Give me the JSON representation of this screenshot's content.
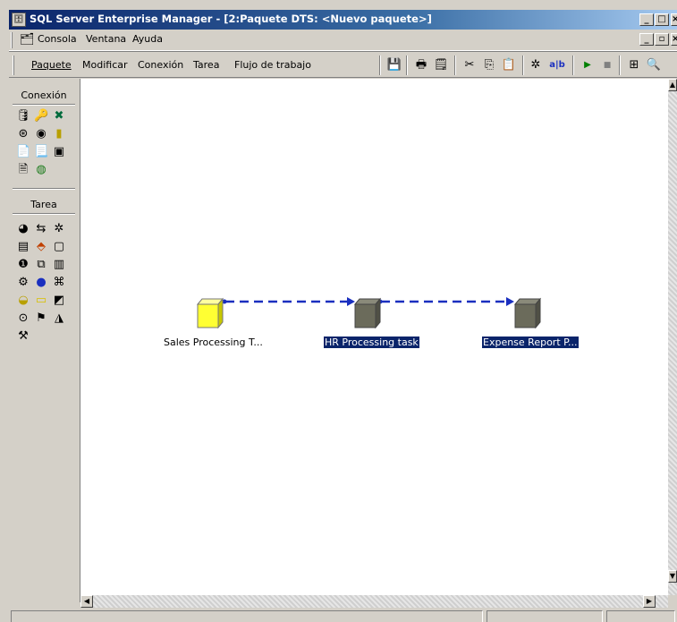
{
  "window": {
    "title": "SQL Server Enterprise Manager - [2:Paquete DTS: <Nuevo paquete>]",
    "controls": [
      "_",
      "□",
      "×"
    ]
  },
  "menubar": {
    "items": [
      "Consola",
      "Ventana",
      "Ayuda"
    ]
  },
  "toolbar": {
    "menus": [
      "Paquete",
      "Modificar",
      "Conexión",
      "Tarea",
      "Flujo de trabajo"
    ],
    "icons": [
      "save-icon",
      "print-icon",
      "properties-icon",
      "cut-icon",
      "copy-icon",
      "paste-icon",
      "transform-icon",
      "text-icon",
      "run-icon",
      "stop-icon",
      "layout-icon",
      "zoom-icon"
    ],
    "text_button": "a|b"
  },
  "left_panel": {
    "connection_title": "Conexión",
    "task_title": "Tarea"
  },
  "tasks": [
    {
      "label": "Sales Processing T...",
      "selected": false
    },
    {
      "label": "HR Processing task",
      "selected": true
    },
    {
      "label": "Expense Report P...",
      "selected": true
    }
  ],
  "colors": {
    "title_start": "#0a246a",
    "selection": "#0a246a",
    "task_yellow": "#ffff33",
    "task_gray": "#6b6b5b",
    "arrow": "#1a2fbf"
  }
}
